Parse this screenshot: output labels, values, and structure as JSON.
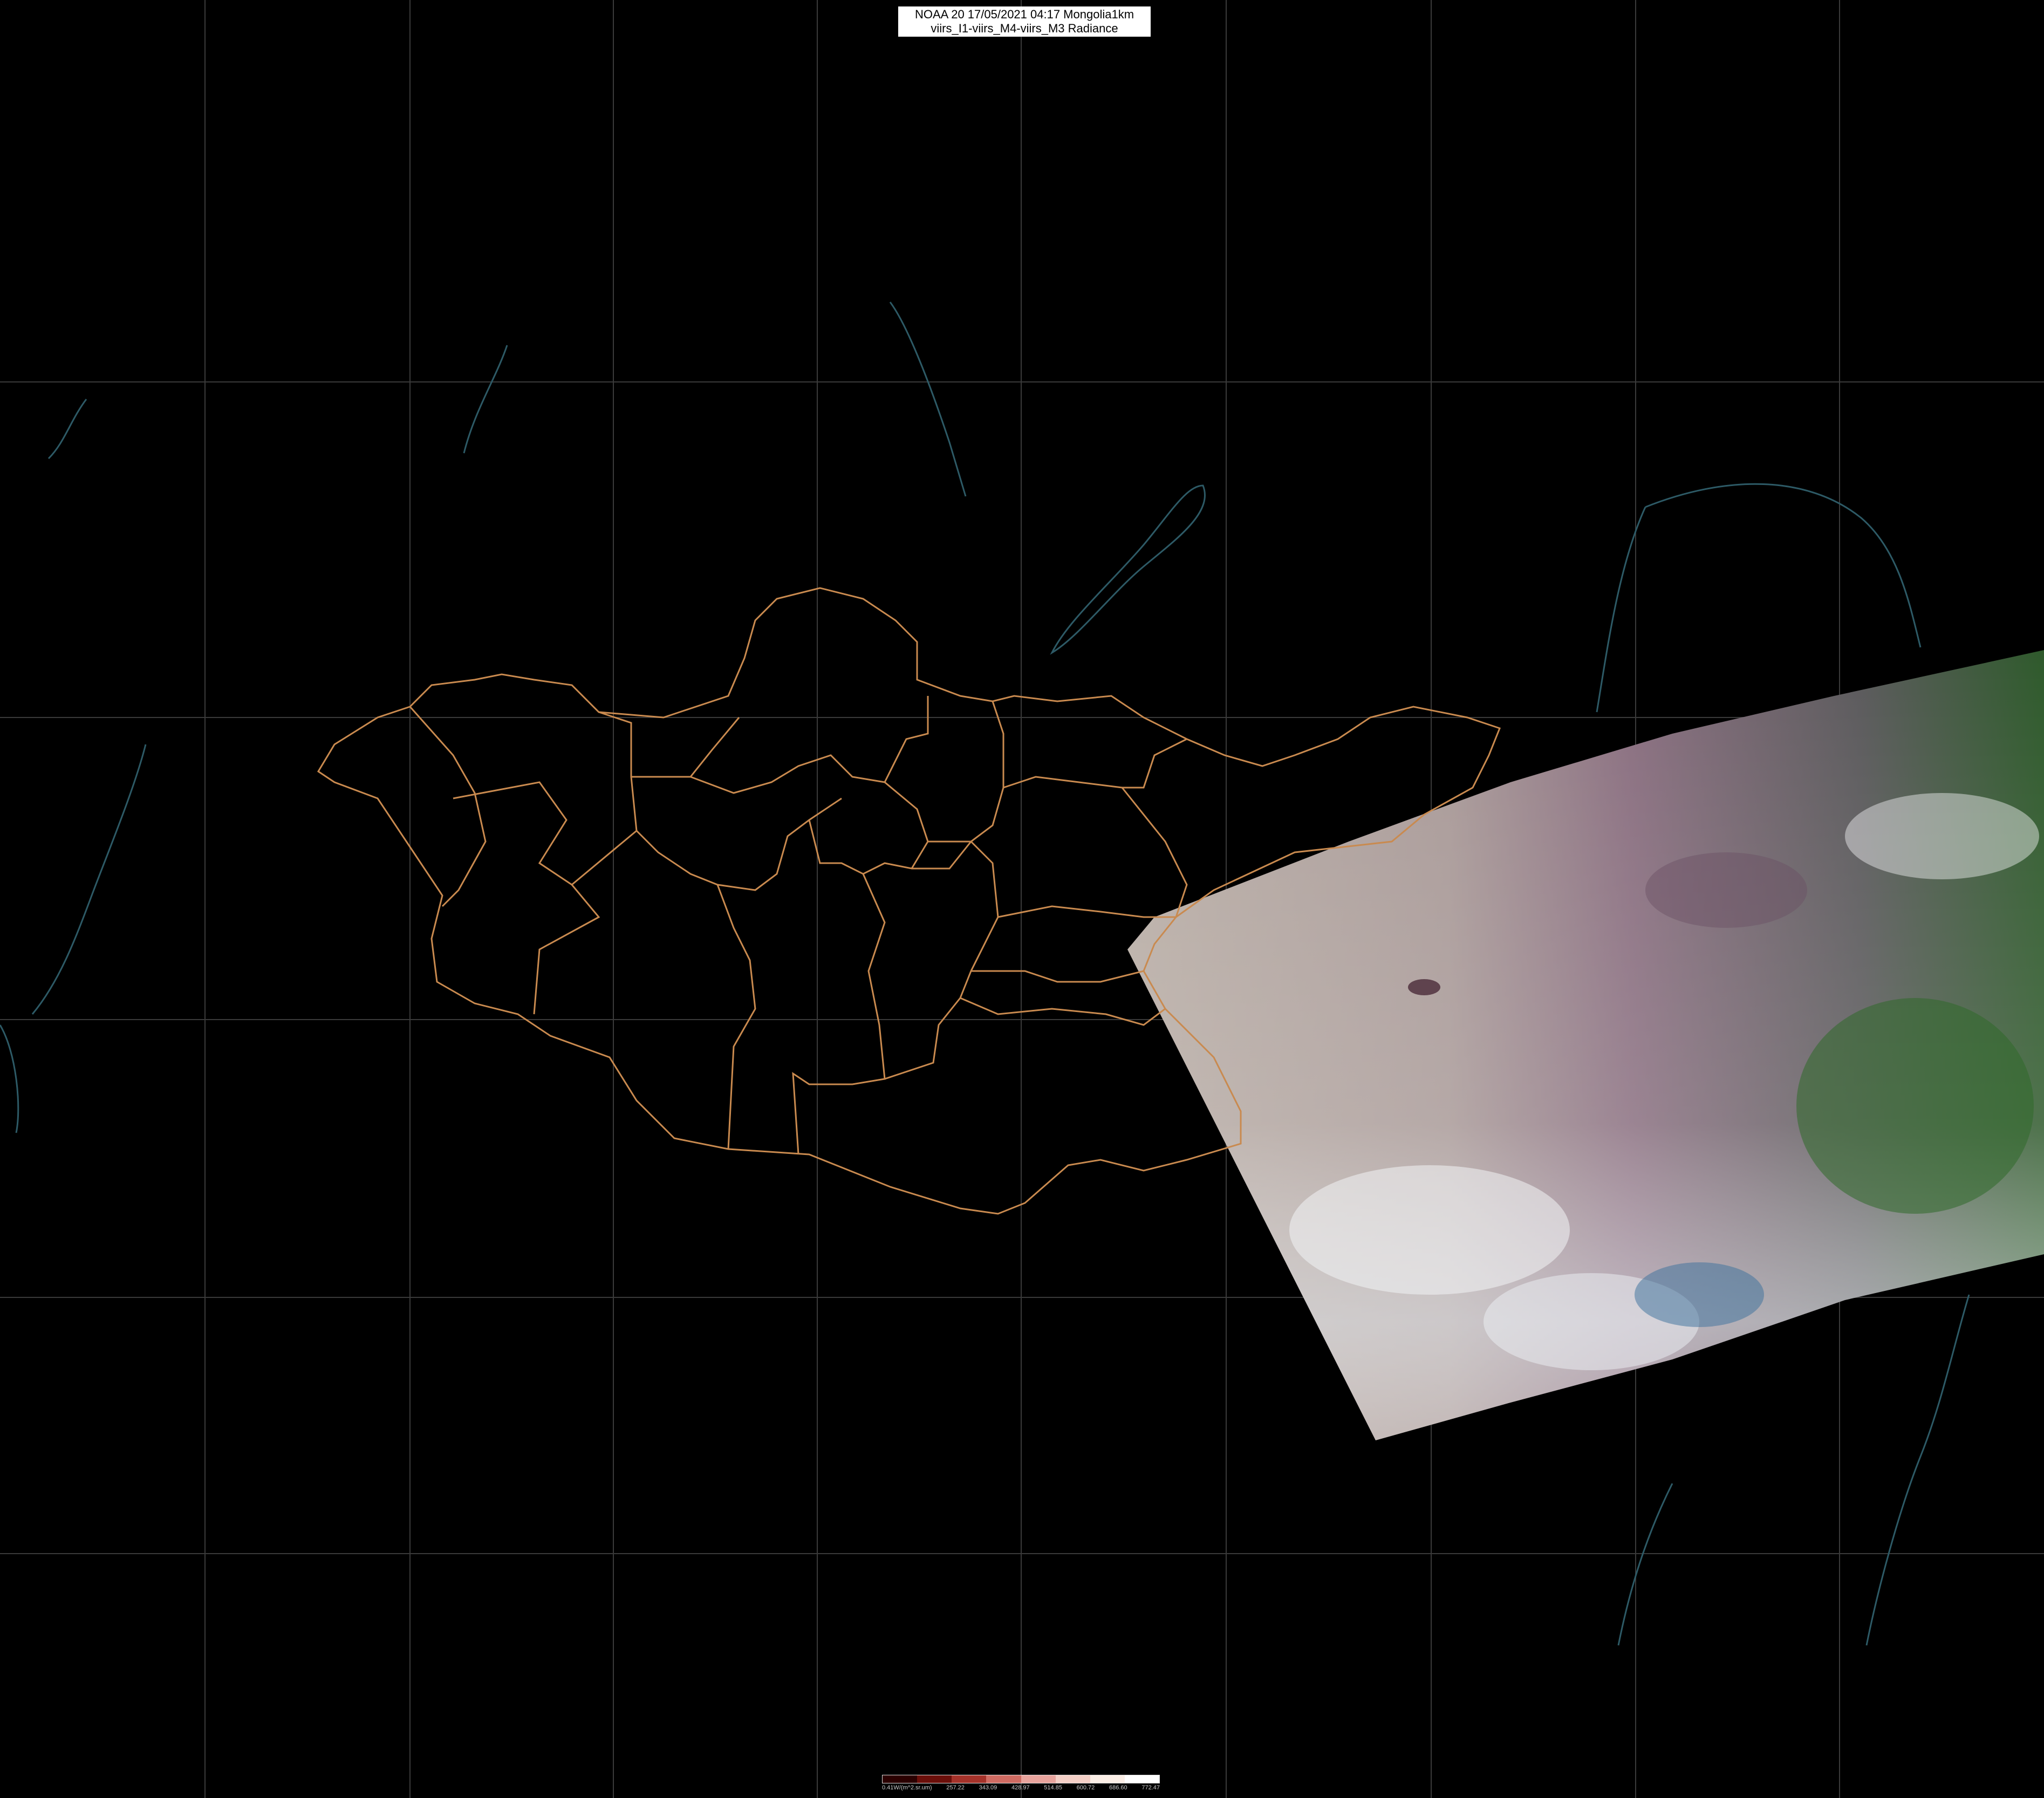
{
  "header": {
    "line1": "NOAA 20 17/05/2021 04:17 Mongolia1km",
    "line2": "viirs_I1-viirs_M4-viirs_M3 Radiance"
  },
  "legend": {
    "ticks": [
      "0.41W/(m^2.sr.um)",
      "257.22",
      "343.09",
      "428.97",
      "514.85",
      "600.72",
      "686.60",
      "772.47"
    ],
    "colors": [
      "#2b0000",
      "#6b0f0a",
      "#a5322a",
      "#cf6b62",
      "#e8a39c",
      "#f4cfc6",
      "#fbeee6",
      "#ffffff"
    ]
  },
  "colors": {
    "background": "#000000",
    "border": "#c98a4f",
    "coast": "#2d5a66",
    "grid": "#3a3a3a"
  }
}
